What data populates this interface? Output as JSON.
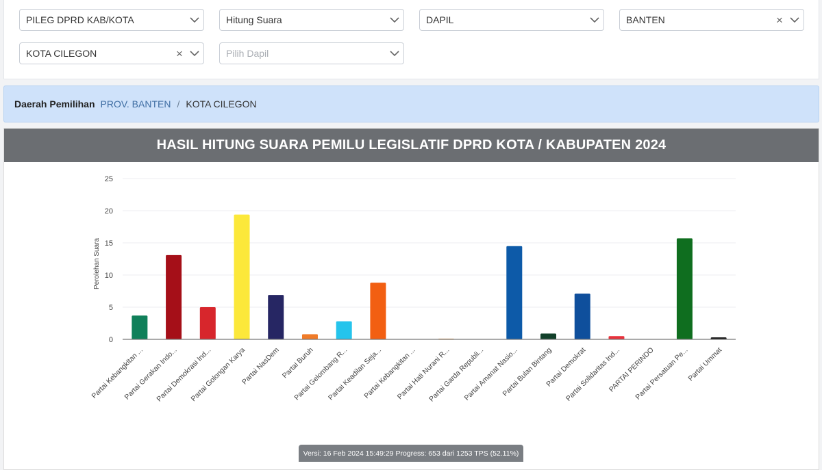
{
  "filters": {
    "election_type": "PILEG DPRD KAB/KOTA",
    "data_type": "Hitung Suara",
    "area_level": "DAPIL",
    "province": "BANTEN",
    "city": "KOTA CILEGON",
    "dapil_placeholder": "Pilih Dapil"
  },
  "breadcrumb": {
    "label": "Daerah Pemilihan",
    "province": "PROV. BANTEN",
    "separator": "/",
    "city": "KOTA CILEGON"
  },
  "chart_title": "HASIL HITUNG SUARA PEMILU LEGISLATIF DPRD KOTA / KABUPATEN 2024",
  "chart_data": {
    "type": "bar",
    "title": "",
    "xlabel": "",
    "ylabel": "Perolehan Suara",
    "ylim": [
      0,
      25
    ],
    "yticks": [
      0,
      5,
      10,
      15,
      20,
      25
    ],
    "grid": true,
    "legend": "none",
    "categories": [
      "Partai Kebangkitan ...",
      "Partai Gerakan Indo...",
      "Partai Demokrasi Ind...",
      "Partai Golongan Karya",
      "Partai NasDem",
      "Partai Buruh",
      "Partai Gelombang R...",
      "Partai Keadilan Seja...",
      "Partai Kebangkitan ...",
      "Partai Hati Nurani R...",
      "Partai Garda Republi...",
      "Partai Amanat Nasio...",
      "Partai Bulan Bintang",
      "Partai Demokrat",
      "Partai Solidaritas Ind...",
      "PARTAI PERINDO",
      "Partai Persatuan Pe...",
      "Partai Ummat"
    ],
    "values": [
      3.7,
      13.1,
      5.0,
      19.4,
      6.9,
      0.8,
      2.8,
      8.8,
      0.05,
      0.1,
      0.05,
      14.5,
      0.9,
      7.1,
      0.5,
      0.05,
      15.7,
      0.3
    ],
    "colors": [
      "#10805a",
      "#a50f18",
      "#d7262c",
      "#fce83a",
      "#262663",
      "#f07b28",
      "#25c4ec",
      "#f25f12",
      "#0e6b3c",
      "#ef8a1f",
      "#c8231f",
      "#0d5aa8",
      "#12402a",
      "#0f4f9c",
      "#e8323c",
      "#1f3f8c",
      "#0f6e1f",
      "#1b1b1b"
    ]
  },
  "version_bar": "Versi: 16 Feb 2024 15:49:29 Progress: 653 dari 1253 TPS (52.11%)",
  "icons": {
    "dropdown": "chevron-down-icon",
    "clear": "clear-icon"
  }
}
